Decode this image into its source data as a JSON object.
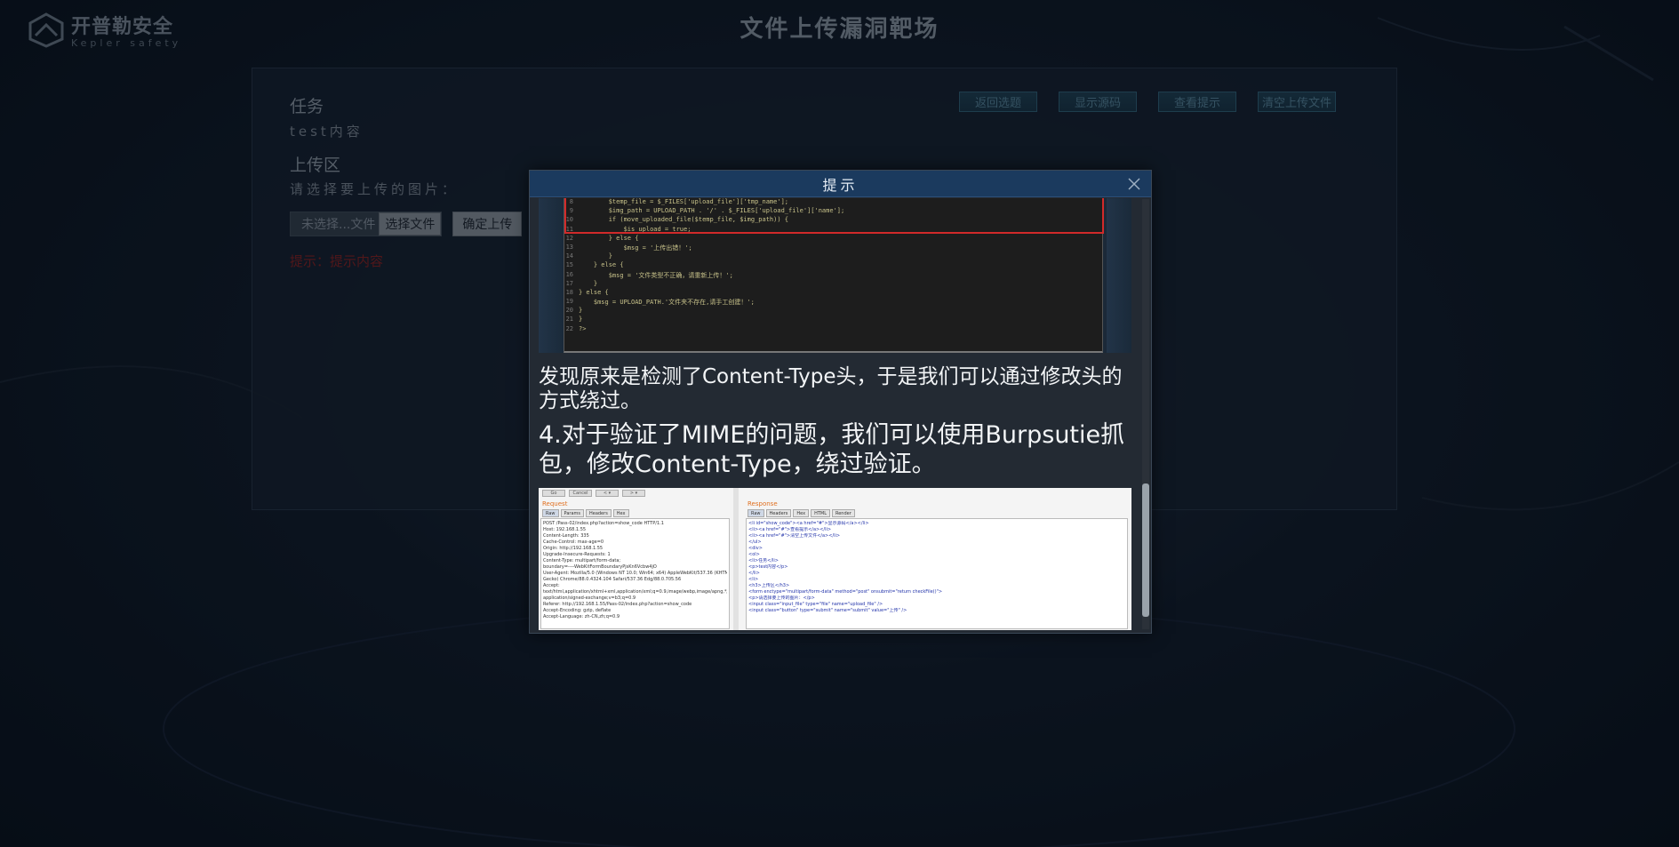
{
  "header": {
    "logo_cn": "开普勒安全",
    "logo_en": "Kepler safety",
    "page_title": "文件上传漏洞靶场"
  },
  "panel": {
    "task_title": "任务",
    "task_content": "test内容",
    "upload_title": "上传区",
    "upload_prompt": "请选择要上传的图片：",
    "file_name": "未选择...文件",
    "choose_file_label": "选择文件",
    "submit_label": "确定上传",
    "hint_text": "提示：提示内容"
  },
  "top_buttons": [
    {
      "label": "返回选题"
    },
    {
      "label": "显示源码"
    },
    {
      "label": "查看提示"
    },
    {
      "label": "清空上传文件"
    }
  ],
  "dialog": {
    "title": "提示",
    "code_lines": [
      {
        "ln": "8",
        "text": "        $temp_file = $_FILES['upload_file']['tmp_name'];"
      },
      {
        "ln": "9",
        "text": "        $img_path = UPLOAD_PATH . '/' . $_FILES['upload_file']['name'];"
      },
      {
        "ln": "10",
        "text": "        if (move_uploaded_file($temp_file, $img_path)) {"
      },
      {
        "ln": "11",
        "text": "            $is_upload = true;"
      },
      {
        "ln": "12",
        "text": "        } else {"
      },
      {
        "ln": "13",
        "text": "            $msg = '上传出错！';"
      },
      {
        "ln": "14",
        "text": "        }"
      },
      {
        "ln": "15",
        "text": "    } else {"
      },
      {
        "ln": "16",
        "text": "        $msg = '文件类型不正确，请重新上传！';"
      },
      {
        "ln": "17",
        "text": "    }"
      },
      {
        "ln": "18",
        "text": "} else {"
      },
      {
        "ln": "19",
        "text": "    $msg = UPLOAD_PATH.'文件夹不存在,请手工创建！';"
      },
      {
        "ln": "20",
        "text": "}"
      },
      {
        "ln": "21",
        "text": "}"
      },
      {
        "ln": "22",
        "text": "?>"
      }
    ],
    "paragraph_1": "发现原来是检测了Content-Type头，于是我们可以通过修改头的方式绕过。",
    "paragraph_2": "4.对于验证了MIME的问题，我们可以使用Burpsutie抓包，修改Content-Type，绕过验证。",
    "burp": {
      "request_label": "Request",
      "response_label": "Response",
      "request_tabs": [
        "Raw",
        "Params",
        "Headers",
        "Hex"
      ],
      "response_tabs": [
        "Raw",
        "Headers",
        "Hex",
        "HTML",
        "Render"
      ],
      "toolbar": [
        "Go",
        "Cancel",
        "< ▾",
        "> ▾"
      ],
      "request_lines": [
        "POST /Pass-02/index.php?action=show_code HTTP/1.1",
        "Host: 192.168.1.55",
        "Content-Length: 335",
        "Cache-Control: max-age=0",
        "Origin: http://192.168.1.55",
        "Upgrade-Insecure-Requests: 1",
        "Content-Type: multipart/form-data;",
        "boundary=----WebKitFormBoundaryPjsKn6Vcbw4jO",
        "User-Agent: Mozilla/5.0 (Windows NT 10.0; Win64; x64) AppleWebKit/537.36 (KHTML, like",
        "Gecko) Chrome/88.0.4324.104 Safari/537.36 Edg/88.0.705.56",
        "Accept:",
        "text/html,application/xhtml+xml,application/xml;q=0.9,image/webp,image/apng,*/*;q=0.8",
        "application/signed-exchange;v=b3;q=0.9",
        "Referer: http://192.168.1.55/Pass-02/index.php?action=show_code",
        "Accept-Encoding: gzip, deflate",
        "Accept-Language: zh-CN,zh;q=0.9"
      ],
      "response_lines": [
        "              <li id=\"show_code\"><a href=\"#\">显示源码</a></li>",
        "              <li><a href=\"#\">查看提示</a></li>",
        "              <li><a href=\"#\">清空上传文件</a></li>",
        "",
        "    </ul>",
        "",
        "  <div>",
        "    <ol>",
        "      <li>任务</li>",
        "      <p>test内容</p>",
        "    </li>",
        "    <li>",
        "      <h3>上传区</h3>",
        "      <form enctype=\"multipart/form-data\" method=\"post\" onsubmit=\"return checkFile()\">",
        "        <p>请选择要上传的图片：</p>",
        "        <input class=\"input_file\" type=\"file\" name=\"upload_file\" />",
        "        <input class=\"button\" type=\"submit\" name=\"submit\" value=\"上传\" />"
      ]
    }
  }
}
